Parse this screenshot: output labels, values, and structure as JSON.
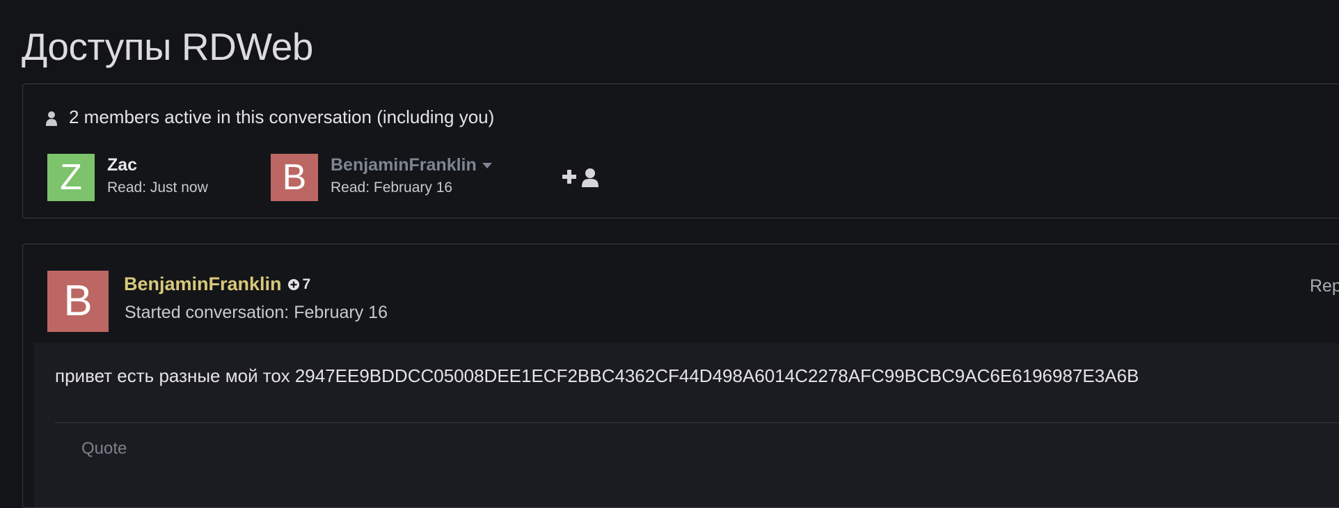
{
  "page": {
    "title": "Доступы RDWeb"
  },
  "members": {
    "heading": "2 members active in this conversation (including you)",
    "list": [
      {
        "avatar_letter": "Z",
        "avatar_color": "#7dc36b",
        "name": "Zac",
        "read": "Read: Just now"
      },
      {
        "avatar_letter": "B",
        "avatar_color": "#bd6764",
        "name": "BenjaminFranklin",
        "read": "Read: February 16",
        "has_dropdown": true
      }
    ],
    "add_member_icon": "add-user-icon"
  },
  "post": {
    "avatar_letter": "B",
    "avatar_color": "#bd6764",
    "author": "BenjaminFranklin",
    "author_color": "#d8c97a",
    "reputation": "7",
    "started": "Started conversation: February 16",
    "report_label": "Report",
    "body": "привет есть разные мой тох 2947EE9BDDCC05008DEE1ECF2BBC4362CF44D498A6014C2278AFC99BCBC9AC6E6196987E3A6B",
    "quote_label": "Quote"
  }
}
